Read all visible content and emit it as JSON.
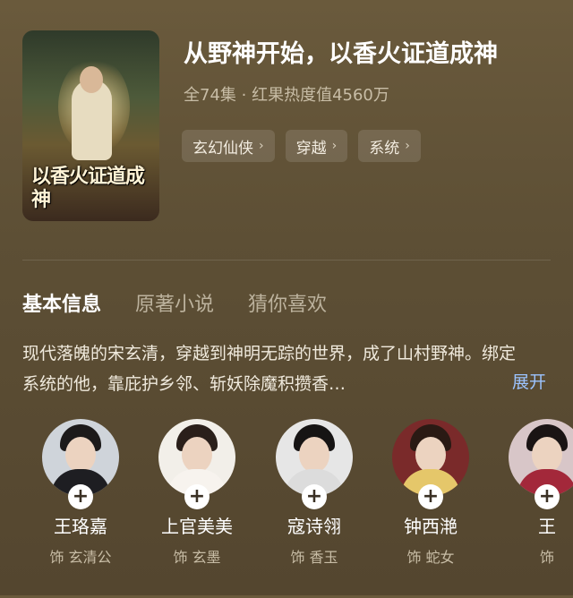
{
  "drama": {
    "title": "从野神开始，以香火证道成神",
    "meta": "全74集 · 红果热度值4560万",
    "poster_title": "以香火证道成神",
    "tags": [
      {
        "label": "玄幻仙侠"
      },
      {
        "label": "穿越"
      },
      {
        "label": "系统"
      }
    ]
  },
  "tabs": [
    {
      "label": "基本信息",
      "active": true
    },
    {
      "label": "原著小说",
      "active": false
    },
    {
      "label": "猜你喜欢",
      "active": false
    }
  ],
  "description": {
    "text": "现代落魄的宋玄清，穿越到神明无踪的世界，成了山村野神。绑定系统的他，靠庇护乡邻、斩妖除魔积攒香…",
    "expand_label": "展开"
  },
  "cast": [
    {
      "name": "王珞嘉",
      "role": "饰 玄清公"
    },
    {
      "name": "上官美美",
      "role": "饰 玄墨"
    },
    {
      "name": "寇诗翎",
      "role": "饰 香玉"
    },
    {
      "name": "钟西滟",
      "role": "饰 蛇女"
    },
    {
      "name": "王",
      "role": "饰"
    }
  ],
  "colors": {
    "background": "#5d4f35",
    "expand_link": "#9cc4ff"
  }
}
